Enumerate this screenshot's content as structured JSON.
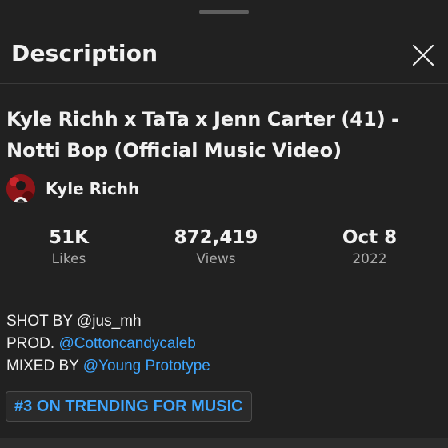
{
  "sheet": {
    "title": "Description"
  },
  "video": {
    "title": "Kyle Richh x TaTa x Jenn Carter (41)  - Notti Bop (Official Music Video)",
    "channel": "Kyle Richh"
  },
  "stats": [
    {
      "value": "51K",
      "label": "Likes"
    },
    {
      "value": "872,419",
      "label": "Views"
    },
    {
      "value": "Oct 8",
      "label": "2022"
    }
  ],
  "description": {
    "line1_prefix": "SHOT BY @jus_mh",
    "line2_prefix": "PROD. ",
    "line2_link": "@Cottoncandycaleb",
    "line3_prefix": "MIXED BY ",
    "line3_link": "@Young Prototype",
    "hashtag": "#3 ON TRENDING FOR MUSIC"
  },
  "colors": {
    "background": "#212121",
    "link": "#3ea6ff",
    "secondary_text": "#aaaaaa"
  },
  "icons": {
    "close": "close-icon"
  }
}
